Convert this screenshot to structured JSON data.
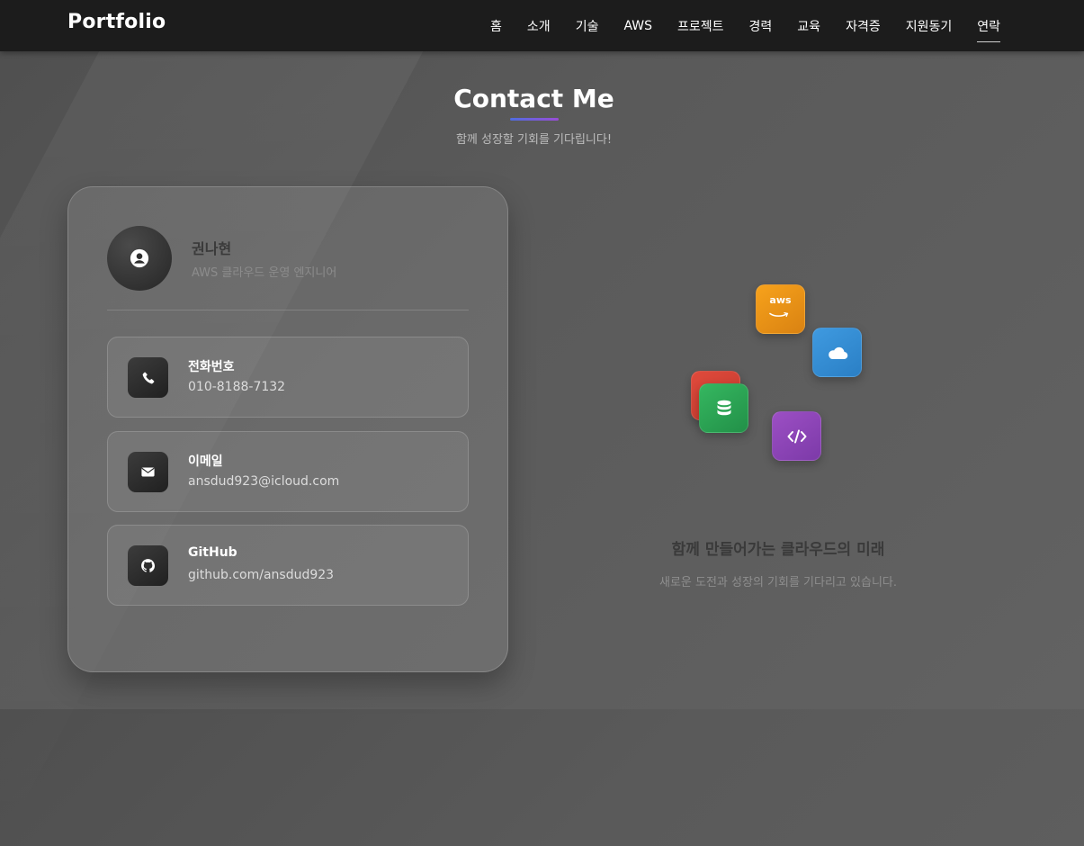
{
  "nav": {
    "brand": "Portfolio",
    "items": [
      {
        "label": "홈"
      },
      {
        "label": "소개"
      },
      {
        "label": "기술"
      },
      {
        "label": "AWS"
      },
      {
        "label": "프로젝트"
      },
      {
        "label": "경력"
      },
      {
        "label": "교육"
      },
      {
        "label": "자격증"
      },
      {
        "label": "지원동기"
      },
      {
        "label": "연락"
      }
    ],
    "active": "연락"
  },
  "header": {
    "title": "Contact Me",
    "subtitle": "함께 성장할 기회를 기다립니다!"
  },
  "profile": {
    "name": "권나현",
    "role": "AWS 클라우드 운영 엔지니어",
    "avatar_icon": "user-circle-icon"
  },
  "contacts": [
    {
      "label": "전화번호",
      "value": "010-8188-7132",
      "icon": "phone-icon"
    },
    {
      "label": "이메일",
      "value": "ansdud923@icloud.com",
      "icon": "envelope-icon"
    },
    {
      "label": "GitHub",
      "value": "github.com/ansdud923",
      "icon": "github-icon"
    }
  ],
  "illustration": {
    "aws_tile_text": "aws",
    "tiles": [
      "aws-icon",
      "cloud-icon",
      "database-icon",
      "code-icon"
    ],
    "colors": {
      "aws": "#f7a21b",
      "cloud": "#3f9ae0",
      "red": "#e04a3c",
      "db": "#35b760",
      "code": "#9c4fc4"
    }
  },
  "closing": {
    "title": "함께 만들어가는 클라우드의 미래",
    "subtitle": "새로운 도전과 성장의 기회를 기다리고 있습니다."
  },
  "colors": {
    "nav_bg": "#1c1c1c",
    "accent_gradient_start": "#4f6de0",
    "accent_gradient_end": "#9a4dd6"
  }
}
